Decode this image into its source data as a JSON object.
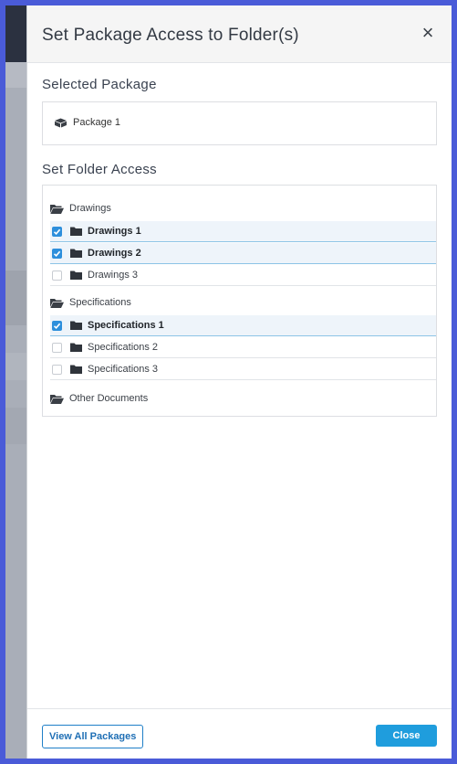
{
  "modal": {
    "title": "Set Package Access to Folder(s)",
    "close_icon": "close-icon",
    "close_glyph": "×"
  },
  "selected_package": {
    "heading": "Selected Package",
    "name": "Package 1",
    "icon": "package-icon"
  },
  "folder_access": {
    "heading": "Set Folder Access",
    "groups": [
      {
        "label": "Drawings",
        "icon": "folder-open-icon",
        "folders": [
          {
            "label": "Drawings 1",
            "checked": true
          },
          {
            "label": "Drawings 2",
            "checked": true
          },
          {
            "label": "Drawings 3",
            "checked": false
          }
        ]
      },
      {
        "label": "Specifications",
        "icon": "folder-open-icon",
        "folders": [
          {
            "label": "Specifications 1",
            "checked": true
          },
          {
            "label": "Specifications 2",
            "checked": false
          },
          {
            "label": "Specifications 3",
            "checked": false
          }
        ]
      },
      {
        "label": "Other Documents",
        "icon": "folder-open-icon",
        "folders": []
      }
    ]
  },
  "footer": {
    "view_all_label": "View All Packages",
    "close_label": "Close"
  },
  "colors": {
    "frame": "#4a5bd8",
    "accent": "#1f9ddd",
    "checkbox_checked": "#2d8fdc",
    "selected_row_bg": "#eef4fa"
  }
}
